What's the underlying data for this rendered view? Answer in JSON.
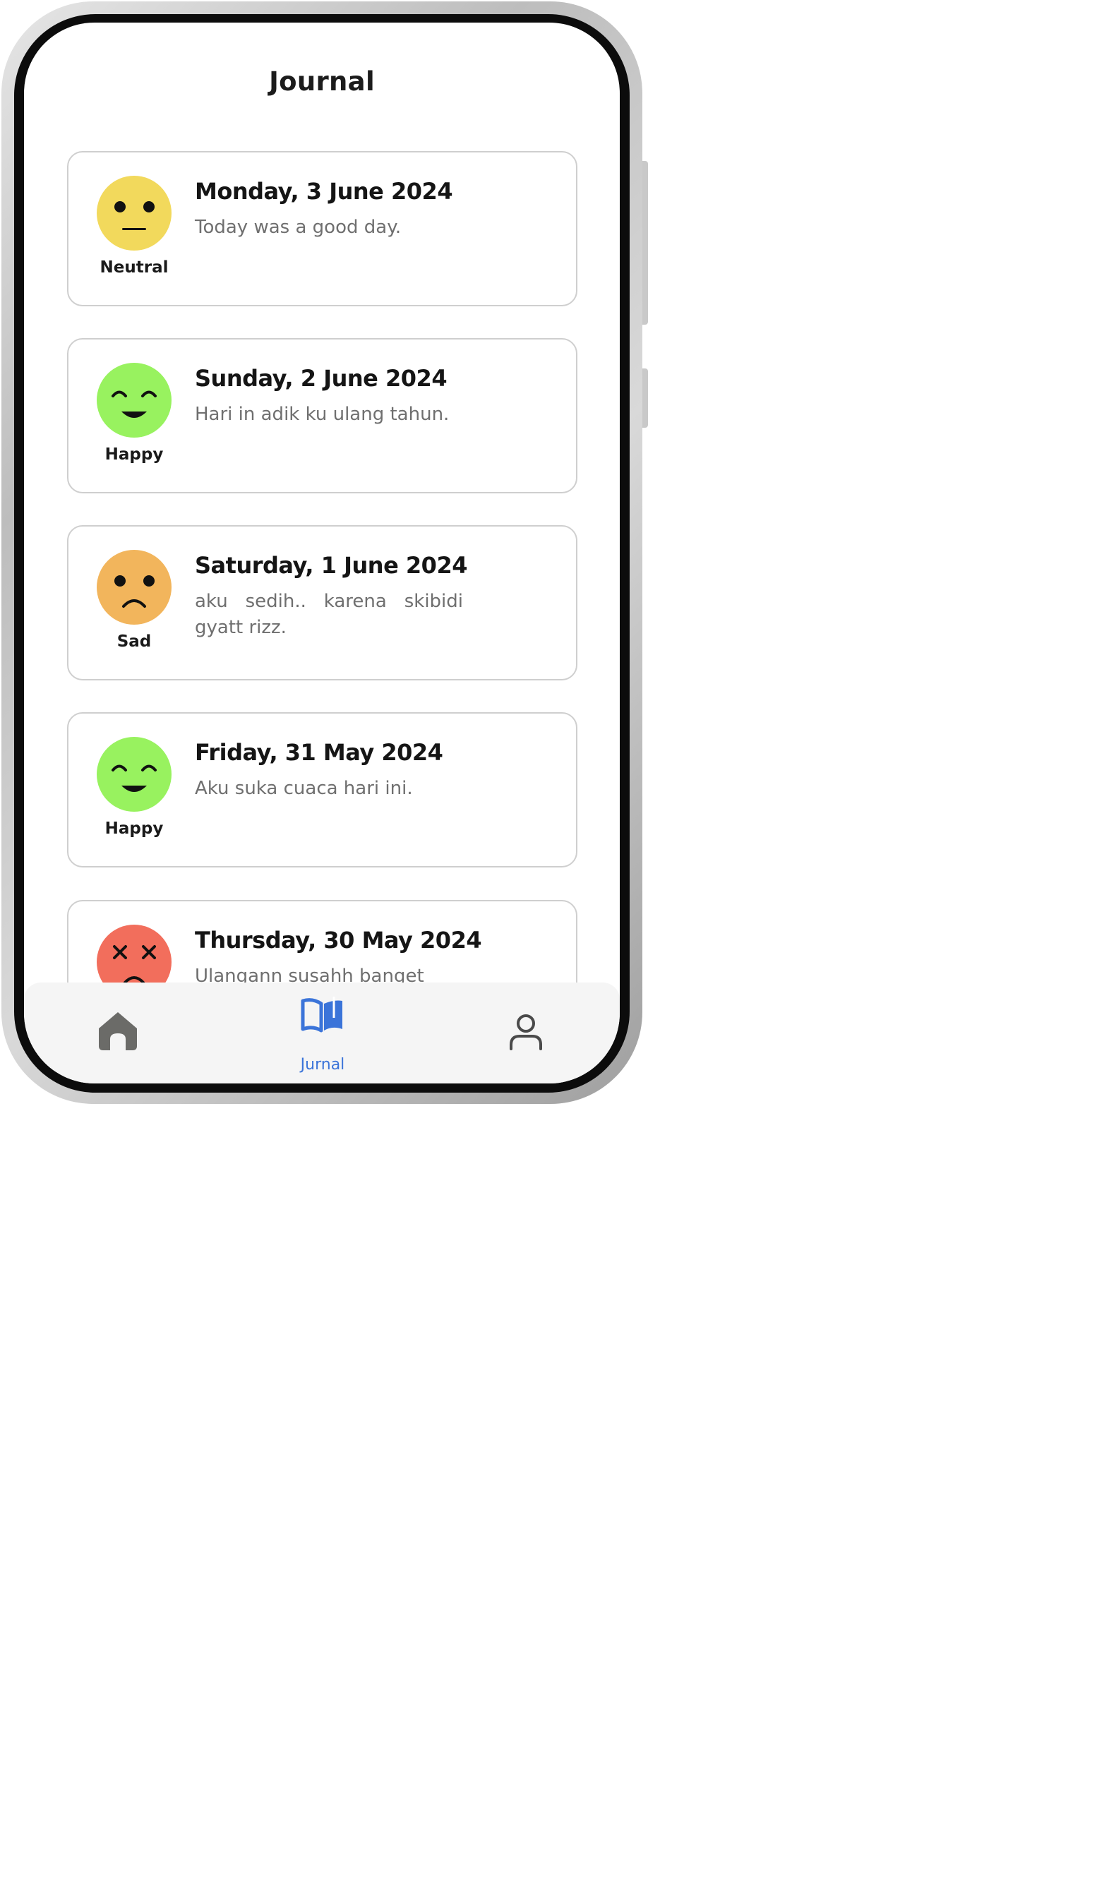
{
  "header": {
    "title": "Journal"
  },
  "entries": [
    {
      "mood": "Neutral",
      "date": "Monday, 3 June 2024",
      "text": "Today was a good day.",
      "face_color": "#f2d95c"
    },
    {
      "mood": "Happy",
      "date": "Sunday, 2 June 2024",
      "text": "Hari in adik ku ulang tahun.",
      "face_color": "#98f25f"
    },
    {
      "mood": "Sad",
      "date": "Saturday, 1 June 2024",
      "text": "aku sedih.. karena skibidi gyatt rizz.",
      "face_color": "#f2b55c"
    },
    {
      "mood": "Happy",
      "date": "Friday, 31 May 2024",
      "text": "Aku suka cuaca hari ini.",
      "face_color": "#98f25f"
    },
    {
      "mood": "",
      "date": "Thursday, 30 May 2024",
      "text": "Ulangann susahh banget",
      "face_color": "#f26e5c"
    }
  ],
  "nav": {
    "items": [
      {
        "icon": "home-icon",
        "label": ""
      },
      {
        "icon": "book-icon",
        "label": "Jurnal",
        "active": true
      },
      {
        "icon": "profile-icon",
        "label": ""
      }
    ],
    "active_color": "#3b74d9",
    "inactive_color": "#6b6b68"
  }
}
